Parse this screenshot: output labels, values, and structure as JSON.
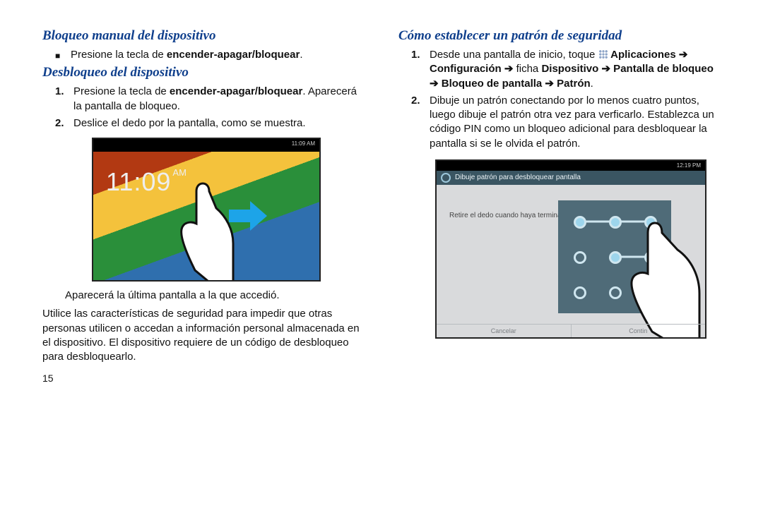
{
  "left": {
    "h1": "Bloqueo manual del dispositivo",
    "bullet1_pre": "Presione la tecla de ",
    "bullet1_bold": "encender-apagar/bloquear",
    "bullet1_post": ".",
    "h2": "Desbloqueo del dispositivo",
    "n1": "1.",
    "n1_pre": "Presione la tecla de ",
    "n1_bold": "encender-apagar/bloquear",
    "n1_post": ". Aparecerá la pantalla de bloqueo.",
    "n2": "2.",
    "n2_text": "Deslice el dedo por la pantalla, como se muestra.",
    "fig": {
      "clock": "11:09",
      "ampm": "AM",
      "status": "11:09 AM"
    },
    "after1": "Aparecerá la última pantalla a la que accedió.",
    "after2": "Utilice las características de seguridad para impedir que otras personas utilicen o accedan a información personal almacenada en el dispositivo. El dispositivo requiere de un código de desbloqueo para desbloquearlo.",
    "page": "15"
  },
  "right": {
    "h1": "Cómo establecer un patrón de seguridad",
    "n1": "1.",
    "n1_a": "Desde una pantalla de inicio, toque ",
    "n1_b": " Aplicaciones ➔ Configuración ➔ ",
    "n1_c": "ficha ",
    "n1_d": "Dispositivo ➔ Pantalla de bloqueo ➔ Bloqueo de pantalla ➔ Patrón",
    "n1_e": ".",
    "n2": "2.",
    "n2_text": "Dibuje un patrón conectando por lo menos cuatro puntos, luego dibuje el patrón otra vez para verficarlo. Establezca un código PIN como un bloqueo adicional para desbloquear la pantalla si se le olvida el patrón.",
    "fig": {
      "status": "12:19 PM",
      "title": "Dibuje patrón para desbloquear pantalla",
      "hint": "Retire el dedo cuando haya terminado",
      "btn_left": "Cancelar",
      "btn_right": "Contin"
    }
  }
}
